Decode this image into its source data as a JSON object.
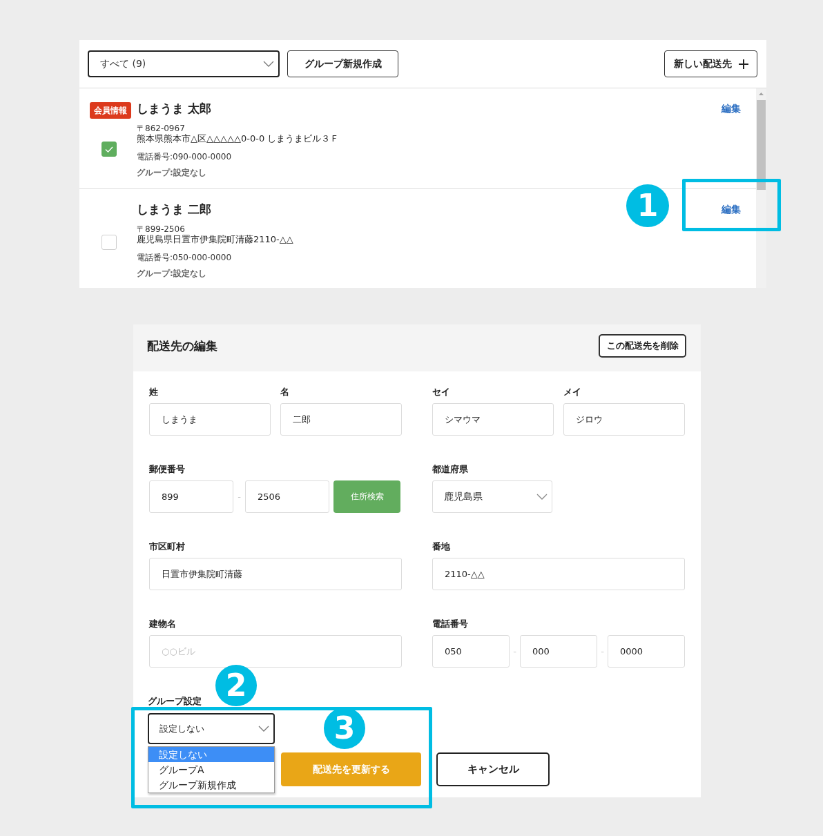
{
  "toolbar": {
    "filter": "すべて (9)",
    "buttons": [
      {
        "label": "グループ新規作成",
        "kind": "plain"
      },
      {
        "label": "新しい配送先",
        "kind": "add"
      }
    ]
  },
  "addresses": [
    {
      "badge": "会員情報",
      "name": "しまうま 太郎",
      "postcode": "〒862-0967",
      "address": "熊本県熊本市△区△△△△△0-0-0 しまうまビル３Ｆ",
      "phone": "電話番号:090-000-0000",
      "group": "グループ:設定なし",
      "checked": true,
      "edit": "編集"
    },
    {
      "name": "しまうま 二郎",
      "postcode": "〒899-2506",
      "address": "鹿児島県日置市伊集院町清藤2110-△△",
      "phone": "電話番号:050-000-0000",
      "group": "グループ:設定なし",
      "checked": false,
      "edit": "編集"
    }
  ],
  "edit_form": {
    "title": "配送先の編集",
    "delete_button": "この配送先を削除",
    "name_fields": [
      {
        "label": "姓",
        "value": "しまうま"
      },
      {
        "label": "名",
        "value": "二郎"
      },
      {
        "label": "セイ",
        "value": "シマウマ"
      },
      {
        "label": "メイ",
        "value": "ジロウ"
      }
    ],
    "postcode": {
      "label": "郵便番号",
      "parts": [
        "899",
        "2506"
      ],
      "separator": "-",
      "search_button": "住所検索"
    },
    "prefecture": {
      "label": "都道府県",
      "value": "鹿児島県"
    },
    "city": {
      "label": "市区町村",
      "value": "日置市伊集院町清藤"
    },
    "street": {
      "label": "番地",
      "value": "2110-△△"
    },
    "building": {
      "label": "建物名",
      "placeholder": "○○ビル"
    },
    "phone": {
      "label": "電話番号",
      "parts": [
        "050",
        "000",
        "0000"
      ],
      "separator": "-"
    },
    "group": {
      "label": "グループ設定",
      "value": "設定しない",
      "expanded": true,
      "options": [
        {
          "label": "設定しない",
          "selected": true
        },
        {
          "label": "グループA",
          "selected": false
        },
        {
          "label": "グループ新規作成",
          "selected": false
        }
      ]
    },
    "buttons": [
      {
        "label": "配送先を更新する",
        "kind": "primary"
      },
      {
        "label": "キャンセル",
        "kind": "secondary"
      }
    ]
  },
  "callouts": [
    {
      "number": "1"
    },
    {
      "number": "2"
    },
    {
      "number": "3"
    }
  ]
}
